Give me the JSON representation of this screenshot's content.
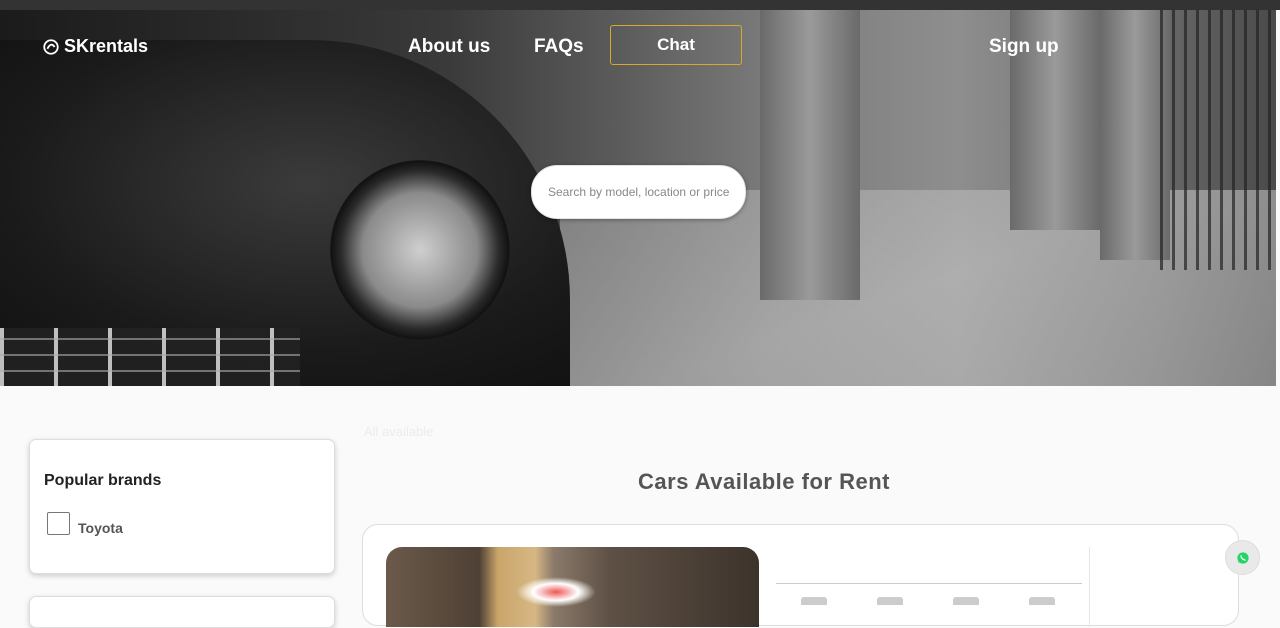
{
  "nav": {
    "brand": "SKrentals",
    "links": {
      "about": "About us",
      "faqs": "FAQs",
      "chat": "Chat",
      "signup": "Sign up"
    }
  },
  "search": {
    "placeholder": "Search by model, location or price",
    "value": ""
  },
  "sidebar": {
    "brands_title": "Popular brands",
    "brands": [
      {
        "label": "Toyota",
        "checked": false
      }
    ]
  },
  "breadcrumb": "All available",
  "main": {
    "title": "Cars Available for Rent"
  },
  "colors": {
    "chat_border": "#d9a92a",
    "whatsapp_green": "#25d366"
  },
  "icons": {
    "logo": "logo-icon",
    "whatsapp": "whatsapp-icon"
  }
}
